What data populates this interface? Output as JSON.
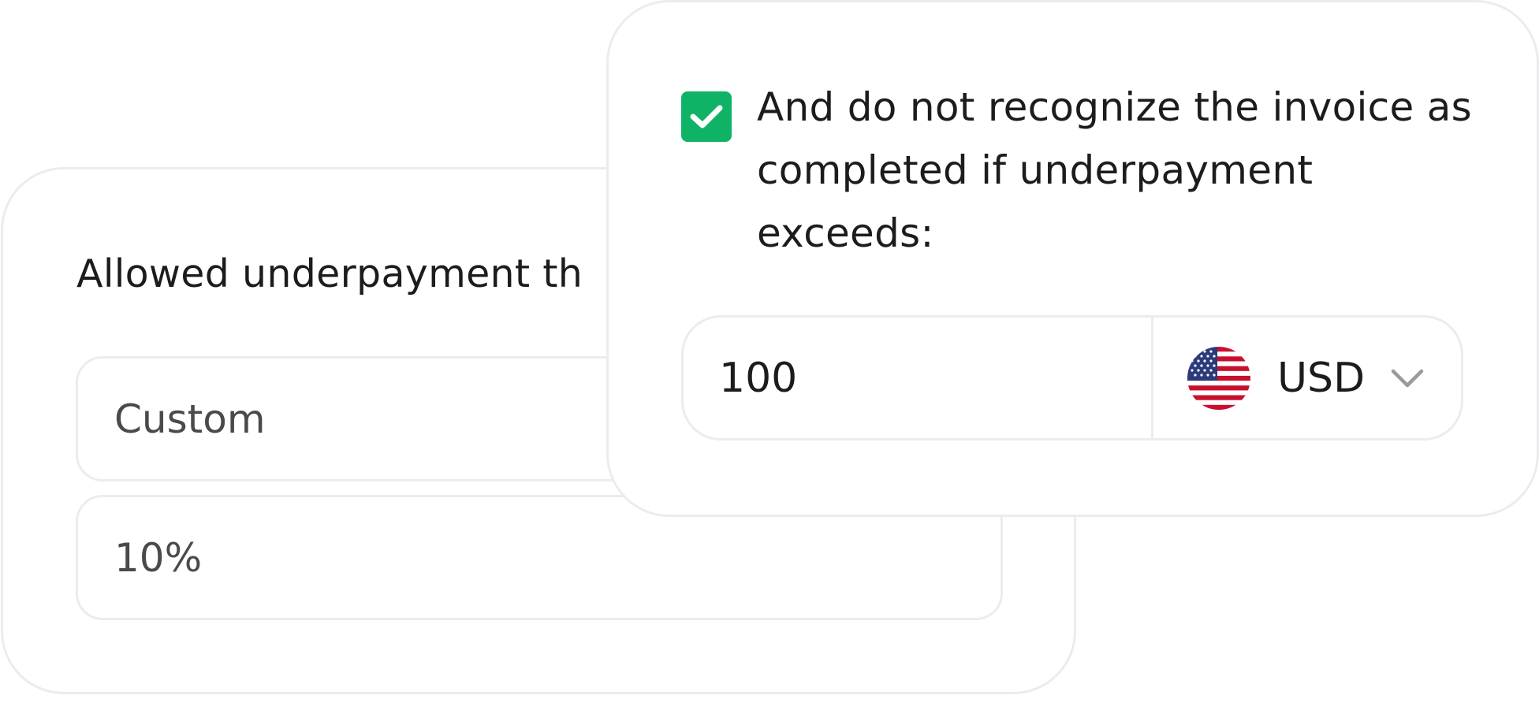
{
  "underpayment_settings": {
    "label": "Allowed underpayment th",
    "threshold_mode": "Custom",
    "threshold_value": "10%"
  },
  "invoice_rule": {
    "checkbox_checked": true,
    "checkbox_label": "And do not recognize the invoice as completed if underpayment exceeds:",
    "amount_value": "100",
    "currency": {
      "code": "USD",
      "flag_icon": "us-flag-icon",
      "dropdown_icon": "chevron-down-icon"
    }
  },
  "colors": {
    "accent_green": "#10b366",
    "border": "#ececee"
  }
}
